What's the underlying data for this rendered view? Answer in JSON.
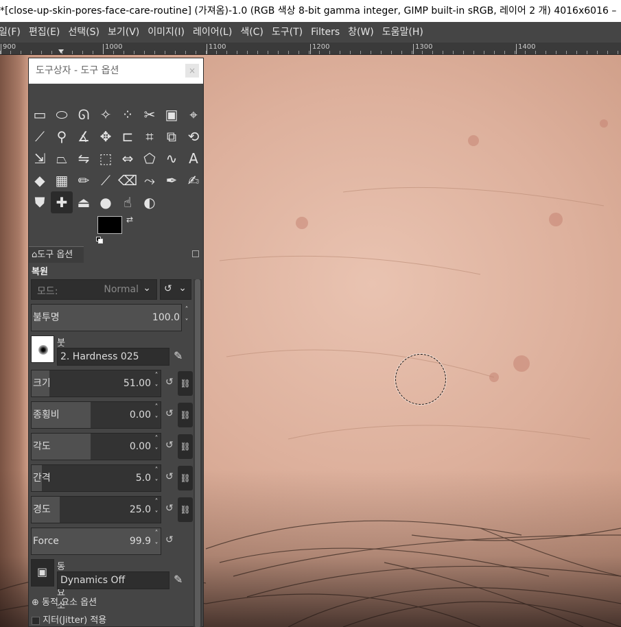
{
  "window": {
    "title": "*[close-up-skin-pores-face-care-routine] (가져옴)-1.0 (RGB 색상 8-bit gamma integer, GIMP built-in sRGB, 레이어 2 개) 4016x6016 –"
  },
  "menubar": [
    "일(F)",
    "편집(E)",
    "선택(S)",
    "보기(V)",
    "이미지(I)",
    "레이어(L)",
    "색(C)",
    "도구(T)",
    "Filters",
    "창(W)",
    "도움말(H)"
  ],
  "ruler": {
    "labels": [
      "900",
      "1000",
      "1100",
      "1200",
      "1300",
      "1400"
    ]
  },
  "toolbox": {
    "title": "도구상자 - 도구 옵션",
    "close": "×",
    "tools": [
      "rect-select-icon",
      "ellipse-select-icon",
      "free-select-icon",
      "fuzzy-select-icon",
      "select-by-color-icon",
      "scissors-select-icon",
      "foreground-select-icon",
      "paths-icon",
      "color-picker-icon",
      "zoom-icon",
      "measure-icon",
      "move-icon",
      "align-icon",
      "crop-icon",
      "unified-transform-icon",
      "rotate-icon",
      "shear-icon",
      "perspective-icon",
      "flip-icon",
      "3d-transform-icon",
      "handle-transform-icon",
      "cage-transform-icon",
      "warp-transform-icon",
      "text-icon",
      "bucket-fill-icon",
      "gradient-icon",
      "pencil-icon",
      "paintbrush-icon",
      "eraser-icon",
      "airbrush-icon",
      "ink-icon",
      "mypaint-brush-icon",
      "clone-icon",
      "heal-icon",
      "perspective-clone-icon",
      "blur-sharpen-icon",
      "smudge-icon",
      "dodge-burn-icon"
    ],
    "active_tool": "heal-icon",
    "colors": {
      "foreground": "#000000",
      "background": "#ffffff"
    }
  },
  "tool_options": {
    "tab_label": "도구 옵션",
    "heading": "복원",
    "mode_label": "모드:",
    "mode_value": "Normal",
    "opacity_label": "불투명",
    "opacity_value": "100.0",
    "brush_label": "붓",
    "brush_value": "2. Hardness 025",
    "sliders": [
      {
        "label": "크기",
        "value": "51.00",
        "fill": 0.14
      },
      {
        "label": "종횡비",
        "value": "0.00",
        "fill": 0.46
      },
      {
        "label": "각도",
        "value": "0.00",
        "fill": 0.46
      },
      {
        "label": "간격",
        "value": "5.0",
        "fill": 0.08
      },
      {
        "label": "경도",
        "value": "25.0",
        "fill": 0.22
      }
    ],
    "force_label": "Force",
    "force_value": "99.9",
    "dynamics_label": "동적 요소",
    "dynamics_value": "Dynamics Off",
    "dynamics_options": "동적 요소 옵션",
    "jitter": "지터(Jitter) 적용"
  }
}
